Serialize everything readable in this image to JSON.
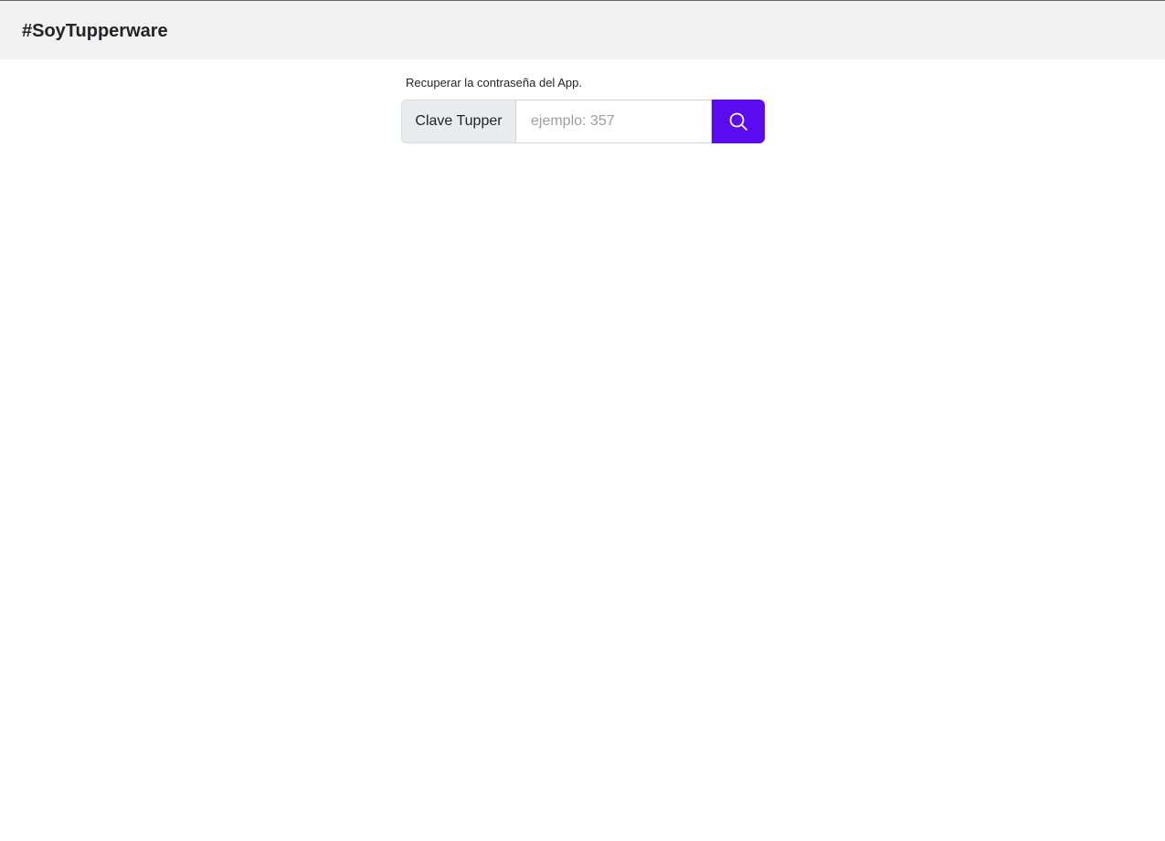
{
  "navbar": {
    "brand": "#SoyTupperware"
  },
  "recover": {
    "label": "Recuperar la contraseña del App.",
    "addon_label": "Clave Tupper",
    "input_value": "",
    "input_placeholder": "ejemplo: 357",
    "search_icon": "search-icon"
  },
  "colors": {
    "navbar_bg": "#f1f1f1",
    "accent": "#5a0bf0",
    "addon_bg": "#e9ecef"
  }
}
